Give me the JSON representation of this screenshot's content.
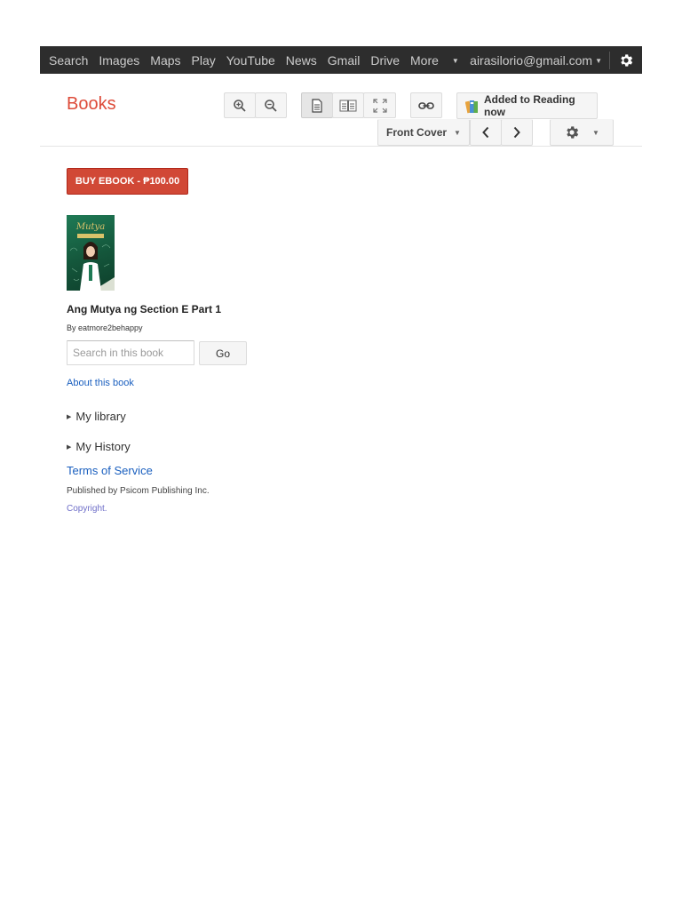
{
  "topbar": {
    "nav": [
      "Search",
      "Images",
      "Maps",
      "Play",
      "YouTube",
      "News",
      "Gmail",
      "Drive"
    ],
    "more_label": "More",
    "account_email": "airasilorio@gmail.com",
    "settings_icon": "gear-icon"
  },
  "header": {
    "brand": "Books",
    "toolbar": {
      "zoom_in_icon": "zoom-in-icon",
      "zoom_out_icon": "zoom-out-icon",
      "one_page_icon": "single-page-icon",
      "two_page_icon": "two-page-icon",
      "fullscreen_icon": "fullscreen-icon",
      "link_icon": "link-icon",
      "reading_now_label": "Added to Reading now",
      "page_select_label": "Front Cover",
      "prev_icon": "chevron-left-icon",
      "next_icon": "chevron-right-icon",
      "settings_icon": "gear-icon"
    }
  },
  "sidebar": {
    "buy_label": "BUY EBOOK - ₱100.00",
    "book": {
      "title": "Ang Mutya ng Section E Part 1",
      "author": "By eatmore2behappy"
    },
    "search": {
      "placeholder": "Search in this book",
      "value": "",
      "go_label": "Go"
    },
    "about_link": "About this book",
    "sections": [
      "My library",
      "My History"
    ],
    "terms_link": "Terms of Service",
    "publisher_text": "Published by Psicom Publishing Inc.",
    "copyright_link": "Copyright."
  },
  "colors": {
    "brand": "#dd4b39",
    "buy_button": "#d14836",
    "link": "#1a5fbf",
    "topbar": "#2d2d2d"
  }
}
